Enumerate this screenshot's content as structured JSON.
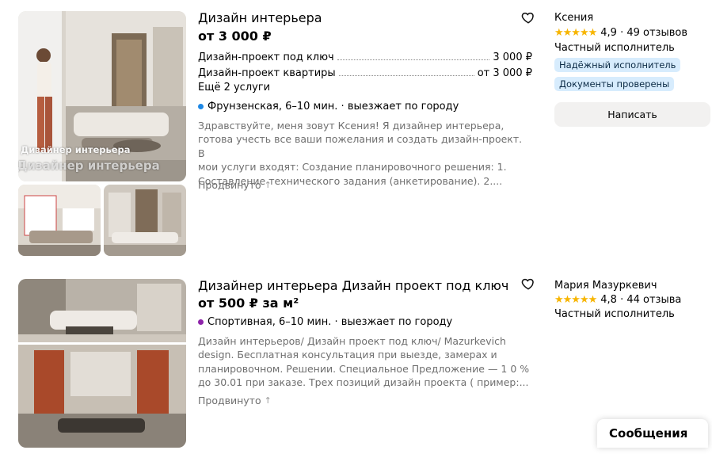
{
  "listings": [
    {
      "title": "Дизайн интерьера",
      "price": "от 3 000 ₽",
      "services": [
        {
          "label": "Дизайн-проект под ключ",
          "value": "3 000 ₽"
        },
        {
          "label": "Дизайн-проект квартиры",
          "value": "от 3 000 ₽"
        }
      ],
      "more_services": "Ещё 2 услуги",
      "address": "Фрунзенская, 6–10 мин. · выезжает по городу",
      "metro_color": "#1e88e5",
      "description_lines": [
        "Здравствуйте, меня зовут Ксения! Я дизайнер интерьера,",
        "готова учесть все ваши пожелания и создать дизайн-проект. В",
        "мои услуги входят: Создание планировочного решения: 1.",
        "Составление технического задания (анкетирование). 2...."
      ],
      "promoted": "Продвинуто",
      "promoted_icon": "↑",
      "seller": {
        "name": "Ксения",
        "stars": "★★★★★",
        "rating": "4,9 · 49 отзывов",
        "type": "Частный исполнитель",
        "badges": [
          "Надёжный исполнитель",
          "Документы проверены"
        ],
        "write_button": "Написать"
      },
      "photo_overlay": [
        "Дизайнер интерьера",
        "Дизайнер интерьера"
      ],
      "favorite_icon": "heart-icon"
    },
    {
      "title": "Дизайнер интерьера Дизайн проект под ключ",
      "price": "от 500 ₽ за м²",
      "address": "Спортивная, 6–10 мин. · выезжает по городу",
      "metro_color": "#8e24aa",
      "description_lines": [
        "Дизайн интерьеров/ Дизайн проект под ключ/ Mazurkevich",
        "design. Бесплатная консультация при выезде, замерах и",
        "планировочном. Решении. Специальное Предложение — 1 0 %",
        "до 30.01 при заказе. Трех позиций дизайн проекта ( пример:..."
      ],
      "promoted": "Продвинуто",
      "promoted_icon": "↑",
      "seller": {
        "name": "Мария Мазуркевич",
        "stars": "★★★★★",
        "rating": "4,8 · 44 отзыва",
        "type": "Частный исполнитель"
      },
      "favorite_icon": "heart-icon"
    }
  ],
  "messages_label": "Сообщения"
}
